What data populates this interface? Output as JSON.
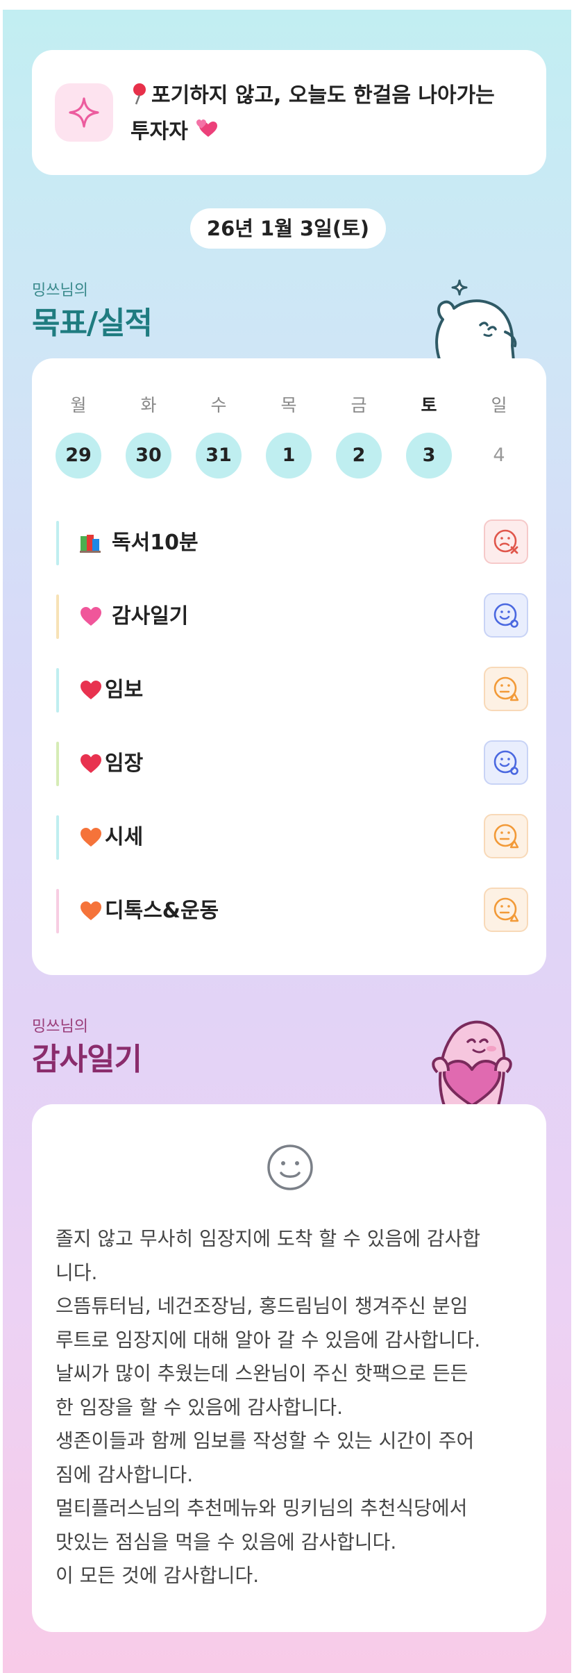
{
  "motto": {
    "line1": "포기하지 않고, 오늘도 한걸음 나아가는",
    "line2": "투자자"
  },
  "date": "26년 1월 3일(토)",
  "goals_section": {
    "subtitle": "밍쓰님의",
    "title": "목표/실적"
  },
  "week": {
    "days": [
      {
        "dow": "월",
        "num": "29"
      },
      {
        "dow": "화",
        "num": "30"
      },
      {
        "dow": "수",
        "num": "31"
      },
      {
        "dow": "목",
        "num": "1"
      },
      {
        "dow": "금",
        "num": "2"
      },
      {
        "dow": "토",
        "num": "3"
      },
      {
        "dow": "일",
        "num": "4"
      }
    ]
  },
  "goals": [
    {
      "label": "독서10분",
      "icon": "books-icon",
      "bar_color": "#bfeef0",
      "status": "fail"
    },
    {
      "label": "감사일기",
      "icon": "heart-icon",
      "bar_color": "#f7e2b6",
      "status": "good"
    },
    {
      "label": "임보",
      "icon": "heart-icon",
      "bar_color": "#bfeef0",
      "status": "mid"
    },
    {
      "label": "임장",
      "icon": "heart-icon",
      "bar_color": "#d6ecb6",
      "status": "good"
    },
    {
      "label": "시세",
      "icon": "orange-heart-icon",
      "bar_color": "#bfeef0",
      "status": "mid"
    },
    {
      "label": "디톡스&운동",
      "icon": "orange-heart-icon",
      "bar_color": "#f7cde2",
      "status": "mid"
    }
  ],
  "gratitude_section": {
    "subtitle": "밍쓰님의",
    "title": "감사일기"
  },
  "gratitude_text": "졸지 않고 무사히 임장지에 도착 할 수 있음에 감사합\n니다.\n으뜸튜터님, 네건조장님, 홍드림님이 챙겨주신 분임\n루트로 임장지에 대해 알아 갈 수 있음에 감사합니다.\n날씨가 많이 추웠는데 스완님이 주신 핫팩으로 든든\n한 임장을 할 수 있음에 감사합니다.\n생존이들과 함께 임보를 작성할 수 있는 시간이 주어\n짐에 감사합니다.\n멀티플러스님의 추천메뉴와 밍키님의 추천식당에서\n맛있는 점심을 먹을 수 있음에 감사합니다.\n이 모든 것에 감사합니다.",
  "colors": {
    "accent_teal": "#1f7c80",
    "accent_plum": "#8a2c6c",
    "day_circle": "#bfeef0"
  }
}
